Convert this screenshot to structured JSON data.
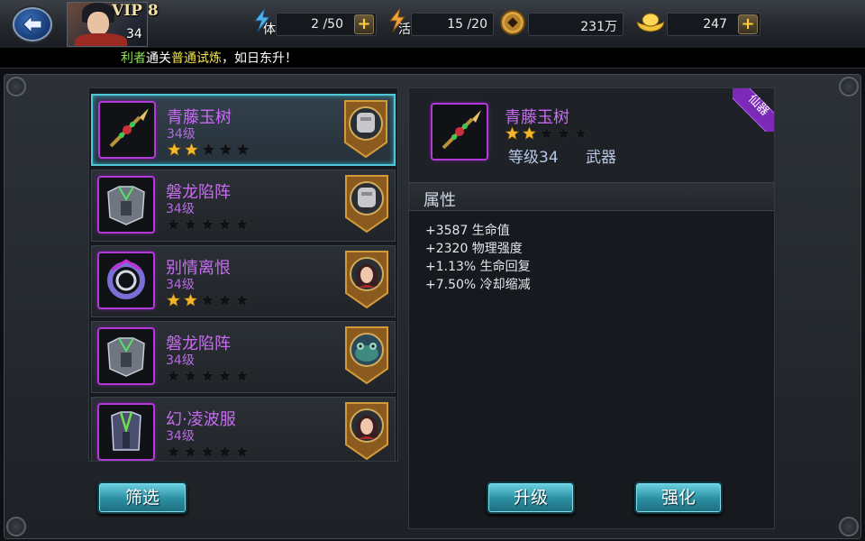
{
  "player": {
    "vip": "VIP 8",
    "level": "34"
  },
  "resources": {
    "stamina": {
      "label": "体",
      "value": "2 /50"
    },
    "energy": {
      "label": "活",
      "value": "15 /20"
    },
    "coins": {
      "value": "231万"
    },
    "ingots": {
      "value": "247"
    }
  },
  "marquee": {
    "part1": "利者",
    "part2": "通关",
    "part3": "普通试炼",
    "part4": "，如日东升！"
  },
  "list": {
    "items": [
      {
        "name": "青藤玉树",
        "level": "34级",
        "stars": 2,
        "selected": true,
        "badge": "armor"
      },
      {
        "name": "磐龙陷阵",
        "level": "34级",
        "stars": 0,
        "selected": false,
        "badge": "armor"
      },
      {
        "name": "别情离恨",
        "level": "34级",
        "stars": 2,
        "selected": false,
        "badge": "lady"
      },
      {
        "name": "磐龙陷阵",
        "level": "34级",
        "stars": 0,
        "selected": false,
        "badge": "toad"
      },
      {
        "name": "幻·凌波服",
        "level": "34级",
        "stars": 0,
        "selected": false,
        "badge": "lady"
      }
    ]
  },
  "detail": {
    "name": "青藤玉树",
    "stars": 2,
    "level": "等级34",
    "type": "武器",
    "rarity": "仙器",
    "attr_title": "属性",
    "attrs": [
      "+3587 生命值",
      "+2320 物理强度",
      "+1.13% 生命回复",
      "+7.50% 冷却缩减"
    ]
  },
  "buttons": {
    "filter": "筛选",
    "upgrade": "升级",
    "enhance": "强化"
  },
  "colors": {
    "accent_cyan": "#4fc7d7",
    "rarity_purple": "#b13ad8",
    "star_gold": "#f4b62a"
  }
}
